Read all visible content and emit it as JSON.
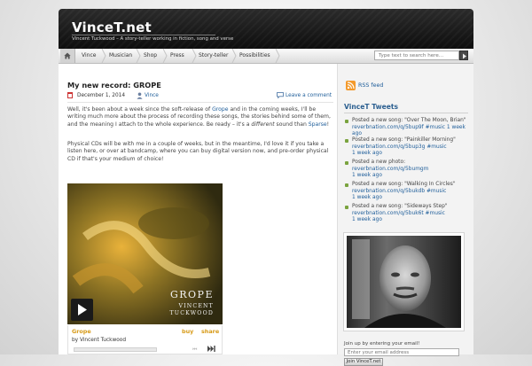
{
  "site": {
    "title": "VinceT.net",
    "description": "Vincent Tuckwood – A story-teller working in fiction, song and verse"
  },
  "nav": {
    "items": [
      "Vince",
      "Musician",
      "Shop",
      "Press",
      "Story-teller",
      "Possibilities"
    ],
    "search_placeholder": "Type text to search here..."
  },
  "post": {
    "title": "My new record: GROPE",
    "date": "December 1, 2014",
    "author": "Vince",
    "comment_link": "Leave a comment",
    "p1": {
      "a": "Well, it's been about a week since the soft-release of ",
      "link1": "Grope",
      "b": " and in the coming weeks, I'll be writing much more about the process of recording these songs, the stories behind some of them, and the meaning I attach to the whole experience. Be ready – it's a ",
      "em": "different",
      "c": " sound than ",
      "link2": "Sparse",
      "d": "!"
    },
    "p2": "Physical CDs will be with me in a couple of weeks, but in the meantime, I'd love it if you take a listen here, or over at bandcamp, where you can buy digital version now, and pre-order physical CD if that's your medium of choice!"
  },
  "player": {
    "cover_title": "GROPE",
    "cover_artist_line1": "VINCENT",
    "cover_artist_line2": "TUCKWOOD",
    "track": "Grope",
    "artist": "by Vincent Tuckwood",
    "buy": "buy",
    "share": "share",
    "prev_icon": "⏮",
    "next_icon": "skip-forward-icon"
  },
  "sidebar": {
    "rss_label": "RSS feed",
    "tweets_heading": "VinceT Tweets",
    "tweets": [
      {
        "text": "Posted a new song: \"Over The Moon, Brian\"",
        "link": "reverbnation.com/q/5bup9f",
        "tag": "#music",
        "ago": "1 week ago"
      },
      {
        "text": "Posted a new song: \"Painkiller Morning\"",
        "link": "reverbnation.com/q/5bup3g",
        "tag": "#music",
        "ago": "1 week ago"
      },
      {
        "text": "Posted a new photo:",
        "link": "reverbnation.com/q/5bumgm",
        "tag": "",
        "ago": "1 week ago"
      },
      {
        "text": "Posted a new song: \"Walking In Circles\"",
        "link": "reverbnation.com/q/5bukdb",
        "tag": "#music",
        "ago": "1 week ago"
      },
      {
        "text": "Posted a new song: \"Sideways Step\"",
        "link": "reverbnation.com/q/5buk6t",
        "tag": "#music",
        "ago": "1 week ago"
      }
    ],
    "join_text": "Join up by entering your email!",
    "email_placeholder": "Enter your email address",
    "join_button": "Join VinceT.net"
  },
  "colors": {
    "link": "#1f5e9a",
    "accent_orange": "#d79a17",
    "header_bg": "#1a1a1a",
    "bullet_green": "#7aa33e"
  }
}
